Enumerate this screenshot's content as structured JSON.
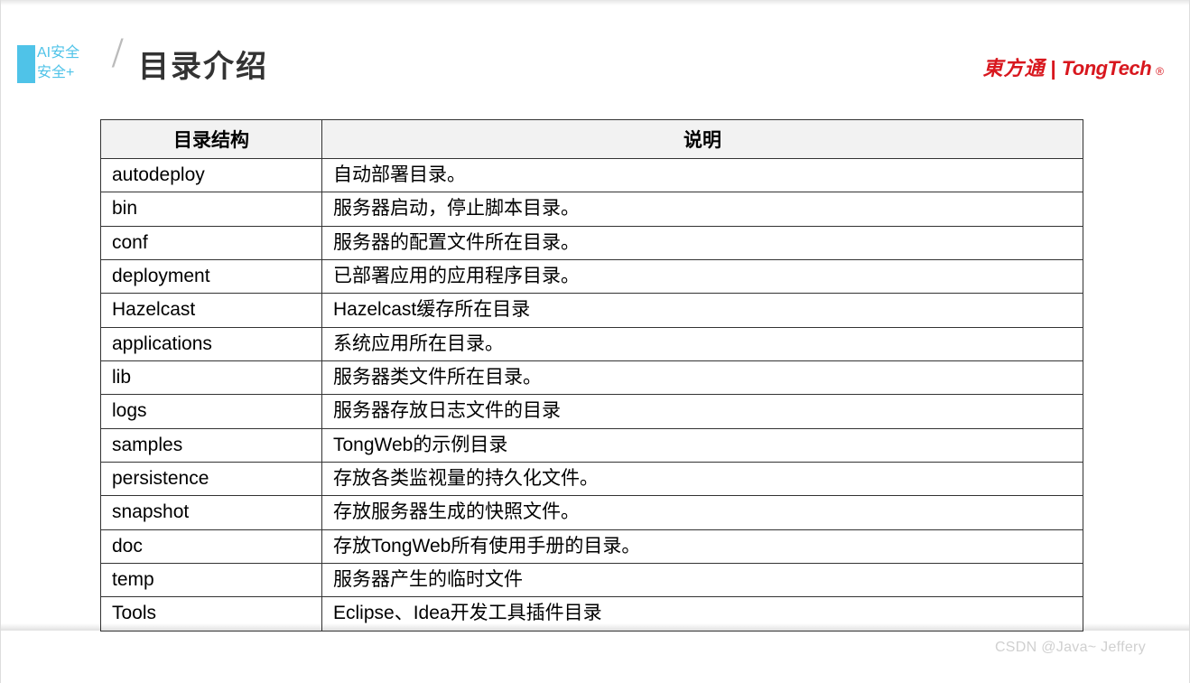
{
  "header": {
    "tag_line1": "AI安全",
    "tag_line2": "安全+",
    "title": "目录介绍",
    "brand_cn": "東方通",
    "brand_en": "TongTech",
    "brand_reg": "®"
  },
  "table": {
    "columns": [
      "目录结构",
      "说明"
    ],
    "rows": [
      {
        "dir": "autodeploy",
        "desc": "自动部署目录。"
      },
      {
        "dir": "bin",
        "desc": "服务器启动，停止脚本目录。"
      },
      {
        "dir": "conf",
        "desc": "服务器的配置文件所在目录。"
      },
      {
        "dir": "deployment",
        "desc": "已部署应用的应用程序目录。"
      },
      {
        "dir": "Hazelcast",
        "desc": "Hazelcast缓存所在目录"
      },
      {
        "dir": "applications",
        "desc": "系统应用所在目录。"
      },
      {
        "dir": "lib",
        "desc": "服务器类文件所在目录。"
      },
      {
        "dir": "logs",
        "desc": "服务器存放日志文件的目录"
      },
      {
        "dir": "samples",
        "desc": "TongWeb的示例目录"
      },
      {
        "dir": "persistence",
        "desc": "存放各类监视量的持久化文件。"
      },
      {
        "dir": "snapshot",
        "desc": "存放服务器生成的快照文件。"
      },
      {
        "dir": "doc",
        "desc": "存放TongWeb所有使用手册的目录。"
      },
      {
        "dir": "temp",
        "desc": "服务器产生的临时文件"
      },
      {
        "dir": "Tools",
        "desc": "Eclipse、Idea开发工具插件目录"
      }
    ]
  },
  "watermark": "CSDN @Java~ Jeffery"
}
